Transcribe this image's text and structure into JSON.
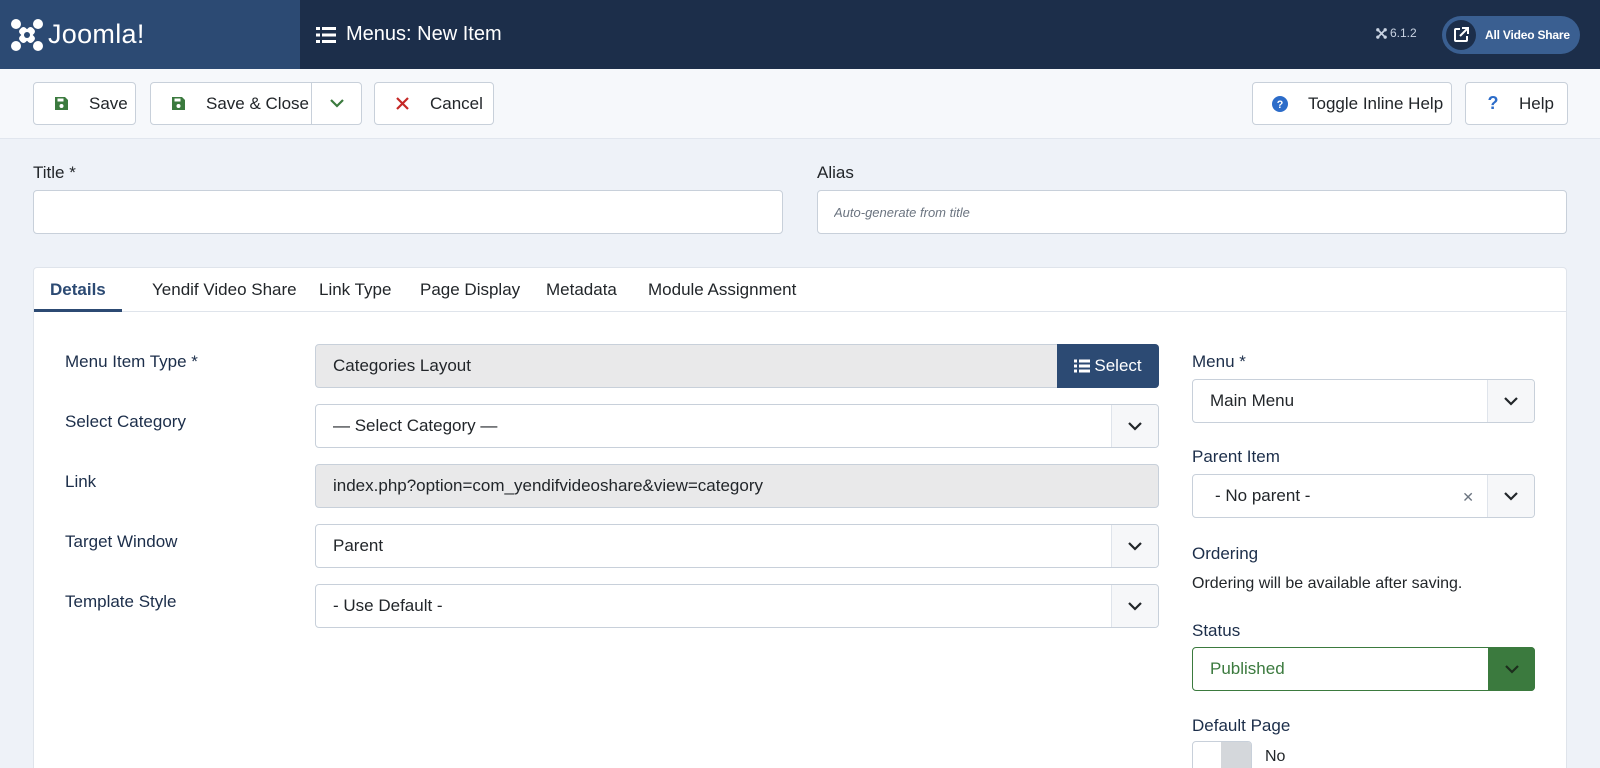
{
  "header": {
    "brand": "Joomla!",
    "page_title": "Menus: New Item",
    "version": "6.1.2",
    "site_button": "All Video Share"
  },
  "toolbar": {
    "save": "Save",
    "save_close": "Save & Close",
    "cancel": "Cancel",
    "toggle_help": "Toggle Inline Help",
    "help": "Help"
  },
  "form": {
    "title_label": "Title *",
    "title_value": "",
    "alias_label": "Alias",
    "alias_placeholder": "Auto-generate from title"
  },
  "tabs": [
    "Details",
    "Yendif Video Share",
    "Link Type",
    "Page Display",
    "Metadata",
    "Module Assignment"
  ],
  "details": {
    "menu_item_type_label": "Menu Item Type *",
    "menu_item_type_value": "Categories Layout",
    "select_button": "Select",
    "select_category_label": "Select Category",
    "select_category_value": "— Select Category —",
    "link_label": "Link",
    "link_value": "index.php?option=com_yendifvideoshare&view=category",
    "target_window_label": "Target Window",
    "target_window_value": "Parent",
    "template_style_label": "Template Style",
    "template_style_value": "- Use Default -"
  },
  "sidebar": {
    "menu_label": "Menu *",
    "menu_value": "Main Menu",
    "parent_label": "Parent Item",
    "parent_value": "- No parent -",
    "ordering_label": "Ordering",
    "ordering_note": "Ordering will be available after saving.",
    "status_label": "Status",
    "status_value": "Published",
    "default_label": "Default Page",
    "default_value": "No"
  },
  "colors": {
    "header_bg": "#1c2e4a",
    "brand_bg": "#2c4a73",
    "accent": "#2c4a73",
    "published_green": "#3b7a3e",
    "cancel_red": "#c52827"
  }
}
